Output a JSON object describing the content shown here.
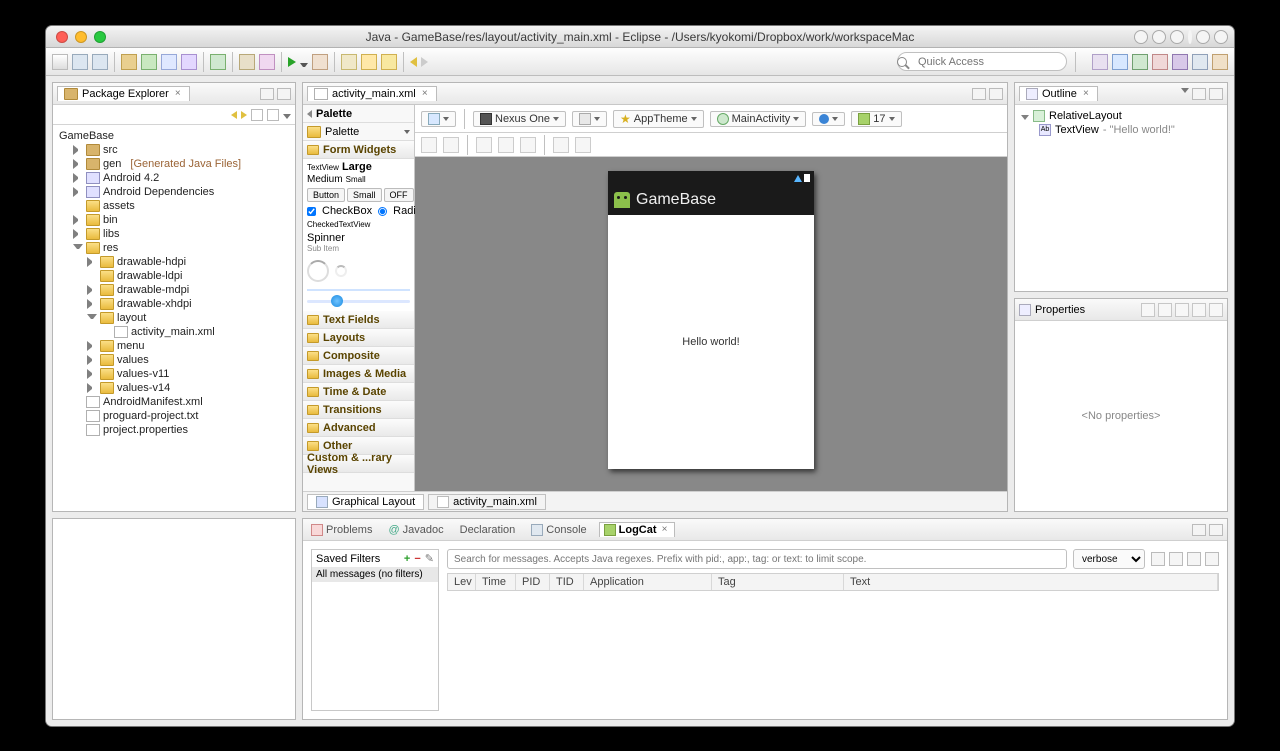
{
  "titlebar": "Java - GameBase/res/layout/activity_main.xml - Eclipse - /Users/kyokomi/Dropbox/work/workspaceMac",
  "quickAccess": {
    "placeholder": "Quick Access"
  },
  "packageExplorer": {
    "title": "Package Explorer",
    "project": "GameBase",
    "nodes": {
      "src": "src",
      "gen": "gen",
      "genNote": "[Generated Java Files]",
      "android": "Android 4.2",
      "dep": "Android Dependencies",
      "assets": "assets",
      "bin": "bin",
      "libs": "libs",
      "res": "res",
      "hdpi": "drawable-hdpi",
      "ldpi": "drawable-ldpi",
      "mdpi": "drawable-mdpi",
      "xhdpi": "drawable-xhdpi",
      "layout": "layout",
      "layoutFile": "activity_main.xml",
      "menu": "menu",
      "values": "values",
      "values11": "values-v11",
      "values14": "values-v14",
      "manifest": "AndroidManifest.xml",
      "proguard": "proguard-project.txt",
      "projprop": "project.properties"
    }
  },
  "editor": {
    "tab": "activity_main.xml",
    "paletteTitle": "Palette",
    "paletteLabel": "Palette",
    "groups": {
      "formWidgets": "Form Widgets",
      "textFields": "Text Fields",
      "layouts": "Layouts",
      "composite": "Composite",
      "images": "Images & Media",
      "time": "Time & Date",
      "transitions": "Transitions",
      "advanced": "Advanced",
      "other": "Other",
      "custom": "Custom & ...rary Views"
    },
    "fw": {
      "textview": "TextView",
      "large": "Large",
      "medium": "Medium",
      "small": "Small",
      "button": "Button",
      "smallBtn": "Small",
      "off": "OFF",
      "checkbox": "CheckBox",
      "radio": "RadioButton",
      "ctv": "CheckedTextView",
      "spinner": "Spinner",
      "subitem": "Sub Item"
    },
    "configBar": {
      "device": "Nexus One",
      "theme": "AppTheme",
      "activity": "MainActivity",
      "api": "17"
    },
    "device": {
      "appName": "GameBase",
      "hello": "Hello world!"
    },
    "footTabs": {
      "gl": "Graphical Layout",
      "xml": "activity_main.xml"
    }
  },
  "outline": {
    "title": "Outline",
    "root": "RelativeLayout",
    "child": "TextView",
    "childVal": " - \"Hello world!\""
  },
  "properties": {
    "title": "Properties",
    "empty": "<No properties>"
  },
  "bottom": {
    "tabs": {
      "problems": "Problems",
      "javadoc": "Javadoc",
      "declaration": "Declaration",
      "console": "Console",
      "logcat": "LogCat"
    },
    "savedFilters": "Saved Filters",
    "allMsgs": "All messages (no filters)",
    "searchPlaceholder": "Search for messages. Accepts Java regexes. Prefix with pid:, app:, tag: or text: to limit scope.",
    "verbose": "verbose",
    "cols": {
      "lev": "Lev",
      "time": "Time",
      "pid": "PID",
      "tid": "TID",
      "app": "Application",
      "tag": "Tag",
      "text": "Text"
    }
  }
}
